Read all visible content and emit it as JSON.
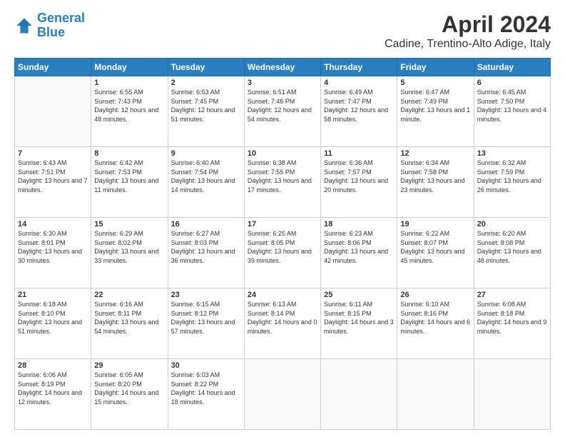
{
  "header": {
    "logo_line1": "General",
    "logo_line2": "Blue",
    "title": "April 2024",
    "subtitle": "Cadine, Trentino-Alto Adige, Italy"
  },
  "days": [
    "Sunday",
    "Monday",
    "Tuesday",
    "Wednesday",
    "Thursday",
    "Friday",
    "Saturday"
  ],
  "weeks": [
    [
      {
        "num": "",
        "empty": true
      },
      {
        "num": "1",
        "sunrise": "Sunrise: 6:55 AM",
        "sunset": "Sunset: 7:43 PM",
        "daylight": "Daylight: 12 hours and 48 minutes."
      },
      {
        "num": "2",
        "sunrise": "Sunrise: 6:53 AM",
        "sunset": "Sunset: 7:45 PM",
        "daylight": "Daylight: 12 hours and 51 minutes."
      },
      {
        "num": "3",
        "sunrise": "Sunrise: 6:51 AM",
        "sunset": "Sunset: 7:46 PM",
        "daylight": "Daylight: 12 hours and 54 minutes."
      },
      {
        "num": "4",
        "sunrise": "Sunrise: 6:49 AM",
        "sunset": "Sunset: 7:47 PM",
        "daylight": "Daylight: 12 hours and 58 minutes."
      },
      {
        "num": "5",
        "sunrise": "Sunrise: 6:47 AM",
        "sunset": "Sunset: 7:49 PM",
        "daylight": "Daylight: 13 hours and 1 minute."
      },
      {
        "num": "6",
        "sunrise": "Sunrise: 6:45 AM",
        "sunset": "Sunset: 7:50 PM",
        "daylight": "Daylight: 13 hours and 4 minutes."
      }
    ],
    [
      {
        "num": "7",
        "sunrise": "Sunrise: 6:43 AM",
        "sunset": "Sunset: 7:51 PM",
        "daylight": "Daylight: 13 hours and 7 minutes."
      },
      {
        "num": "8",
        "sunrise": "Sunrise: 6:42 AM",
        "sunset": "Sunset: 7:53 PM",
        "daylight": "Daylight: 13 hours and 11 minutes."
      },
      {
        "num": "9",
        "sunrise": "Sunrise: 6:40 AM",
        "sunset": "Sunset: 7:54 PM",
        "daylight": "Daylight: 13 hours and 14 minutes."
      },
      {
        "num": "10",
        "sunrise": "Sunrise: 6:38 AM",
        "sunset": "Sunset: 7:55 PM",
        "daylight": "Daylight: 13 hours and 17 minutes."
      },
      {
        "num": "11",
        "sunrise": "Sunrise: 6:36 AM",
        "sunset": "Sunset: 7:57 PM",
        "daylight": "Daylight: 13 hours and 20 minutes."
      },
      {
        "num": "12",
        "sunrise": "Sunrise: 6:34 AM",
        "sunset": "Sunset: 7:58 PM",
        "daylight": "Daylight: 13 hours and 23 minutes."
      },
      {
        "num": "13",
        "sunrise": "Sunrise: 6:32 AM",
        "sunset": "Sunset: 7:59 PM",
        "daylight": "Daylight: 13 hours and 26 minutes."
      }
    ],
    [
      {
        "num": "14",
        "sunrise": "Sunrise: 6:30 AM",
        "sunset": "Sunset: 8:01 PM",
        "daylight": "Daylight: 13 hours and 30 minutes."
      },
      {
        "num": "15",
        "sunrise": "Sunrise: 6:29 AM",
        "sunset": "Sunset: 8:02 PM",
        "daylight": "Daylight: 13 hours and 33 minutes."
      },
      {
        "num": "16",
        "sunrise": "Sunrise: 6:27 AM",
        "sunset": "Sunset: 8:03 PM",
        "daylight": "Daylight: 13 hours and 36 minutes."
      },
      {
        "num": "17",
        "sunrise": "Sunrise: 6:25 AM",
        "sunset": "Sunset: 8:05 PM",
        "daylight": "Daylight: 13 hours and 39 minutes."
      },
      {
        "num": "18",
        "sunrise": "Sunrise: 6:23 AM",
        "sunset": "Sunset: 8:06 PM",
        "daylight": "Daylight: 13 hours and 42 minutes."
      },
      {
        "num": "19",
        "sunrise": "Sunrise: 6:22 AM",
        "sunset": "Sunset: 8:07 PM",
        "daylight": "Daylight: 13 hours and 45 minutes."
      },
      {
        "num": "20",
        "sunrise": "Sunrise: 6:20 AM",
        "sunset": "Sunset: 8:08 PM",
        "daylight": "Daylight: 13 hours and 48 minutes."
      }
    ],
    [
      {
        "num": "21",
        "sunrise": "Sunrise: 6:18 AM",
        "sunset": "Sunset: 8:10 PM",
        "daylight": "Daylight: 13 hours and 51 minutes."
      },
      {
        "num": "22",
        "sunrise": "Sunrise: 6:16 AM",
        "sunset": "Sunset: 8:11 PM",
        "daylight": "Daylight: 13 hours and 54 minutes."
      },
      {
        "num": "23",
        "sunrise": "Sunrise: 6:15 AM",
        "sunset": "Sunset: 8:12 PM",
        "daylight": "Daylight: 13 hours and 57 minutes."
      },
      {
        "num": "24",
        "sunrise": "Sunrise: 6:13 AM",
        "sunset": "Sunset: 8:14 PM",
        "daylight": "Daylight: 14 hours and 0 minutes."
      },
      {
        "num": "25",
        "sunrise": "Sunrise: 6:11 AM",
        "sunset": "Sunset: 8:15 PM",
        "daylight": "Daylight: 14 hours and 3 minutes."
      },
      {
        "num": "26",
        "sunrise": "Sunrise: 6:10 AM",
        "sunset": "Sunset: 8:16 PM",
        "daylight": "Daylight: 14 hours and 6 minutes."
      },
      {
        "num": "27",
        "sunrise": "Sunrise: 6:08 AM",
        "sunset": "Sunset: 8:18 PM",
        "daylight": "Daylight: 14 hours and 9 minutes."
      }
    ],
    [
      {
        "num": "28",
        "sunrise": "Sunrise: 6:06 AM",
        "sunset": "Sunset: 8:19 PM",
        "daylight": "Daylight: 14 hours and 12 minutes."
      },
      {
        "num": "29",
        "sunrise": "Sunrise: 6:05 AM",
        "sunset": "Sunset: 8:20 PM",
        "daylight": "Daylight: 14 hours and 15 minutes."
      },
      {
        "num": "30",
        "sunrise": "Sunrise: 6:03 AM",
        "sunset": "Sunset: 8:22 PM",
        "daylight": "Daylight: 14 hours and 18 minutes."
      },
      {
        "num": "",
        "empty": true
      },
      {
        "num": "",
        "empty": true
      },
      {
        "num": "",
        "empty": true
      },
      {
        "num": "",
        "empty": true
      }
    ]
  ]
}
